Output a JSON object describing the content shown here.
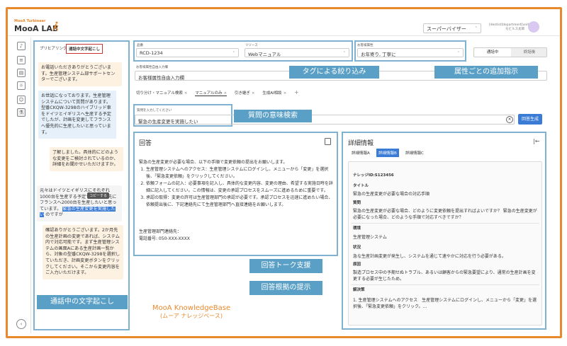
{
  "header": {
    "logo_sub": "MooA Turbineer",
    "logo": "MooA LAB",
    "role": "スーパーバイザー",
    "user_line1": "[dentist]department[unit]",
    "user_line2": "モビルス太郎"
  },
  "left_panel": {
    "tab_preview": "プリヒアリング",
    "tab_transcript": "通話中文字起こし",
    "messages": [
      {
        "type": "orange",
        "text": "お電話いただきありがとうございます。生産管理システム部サポートセンターでございます。"
      },
      {
        "type": "blue",
        "text": "お世話になっております。生産管理システムについて質問があります。型番CKQW-3298のハイブリッド車をドイツとイギリスへ生産する予定でしたが、計画を変更してフランスへ優先的に生産したいと思っています。"
      },
      {
        "type": "orange",
        "text": "了解しました。具体的にどのような変更をご検討されているのか、詳細をお聞かせいただけますか。"
      },
      {
        "type": "grey",
        "text_before": "元々はドイツとイギリスにそれぞれ1000台を生産する予定でしたが、先にフランスへ2000台を生産したいと思っています。",
        "highlight": "緊急の生産変更を実施したい",
        "text_after": "のですが"
      },
      {
        "type": "orange",
        "text": "確認ありがとうございます。2か月先の生産計画の変更であれば、システム内で対応可能です。まず生産管理システムの画面Aにある生産計画一覧から、対象の型番CKQW-3298を選択していただき、計画変更ボタンをクリックしてください。そこから変更内容をご入力いただけます。"
      }
    ],
    "tooltip": "コピーする"
  },
  "filters": {
    "product_label": "品番",
    "product_value": "RCD-1234",
    "resource_label": "リソース",
    "resource_value": "Webマニュアル",
    "attr_label": "お客様属性",
    "attr_value": "お年寄り, 丁寧に",
    "toggle_on": "通話中",
    "toggle_off": "終話後",
    "free_input_label": "お客様属性自由入力欄",
    "free_input_placeholder": "お客様属性自由入力欄"
  },
  "chips": [
    "切り分け・マニュアル検索",
    "マニュアルのみ",
    "引き継ぎ",
    "生成AI相談"
  ],
  "question": {
    "label": "質問を入力してください",
    "value": "緊急の生産変更を実施したい",
    "generate_button": "回答生成"
  },
  "answer": {
    "title": "回答",
    "intro": "緊急の生産変更が必要な場合、以下の手順で変更依頼の提出をお願いします。",
    "steps": [
      "生産管理システムへのアクセス：生産管理システムにログインし、メニューから「変更」を選択後、「緊急変更依頼」をクリックしてください。",
      "依頼フォームの記入：必要事項を記入し、具体的な変更内容、変更の理由、希望する実施日時を詳細に記入してください。この情報は、変更の承認プロセスをスムーズに進めるために重要です。",
      "承認の取得：変更の許可は生産管理部門の承認が必要です。承認プロセスを迅速に進めたい場合、依頼提出後に、下記連絡先にて生産管理部門へ直接連絡をお願いします。"
    ],
    "contact_line1": "生産管理部門連絡先：",
    "contact_line2": "電話番号: 050-XXX-XXXX"
  },
  "detail": {
    "title": "詳細情報",
    "tabs": [
      "詳細情報A",
      "詳細情報B",
      "詳細情報C"
    ],
    "knowledge_id": "ナレッジID:S123456",
    "rows": [
      {
        "k": "タイトル",
        "v": "緊急の生産変更が必要な場合の対応手順"
      },
      {
        "k": "質問",
        "v": "緊急の生産変更が必要な場合、どのように変更依頼を提出すればよいですか？ 緊急の生産変更が必要になった場合、どのような手順で対応すべきですか？"
      },
      {
        "k": "環境",
        "v": "生産管理システム"
      },
      {
        "k": "状況",
        "v": "急な生産計画変更が発生し、システムを通じて速やかに対応を行う必要がある。"
      },
      {
        "k": "原因",
        "v": "製造プロセス中の予期せぬトラブル、あるいは顧客からの緊急要望により、通常の生産計画を変更する必要が生じたため。"
      },
      {
        "k": "解決策",
        "v": "1. 生産管理システムへのアクセス　生産管理システムにログインし、メニューから「変更」を選択後、「緊急変更依頼」をクリック。..."
      }
    ]
  },
  "callouts": {
    "tag_filter": "タグによる絞り込み",
    "attr_instruction": "属性ごとの追加指示",
    "semantic_search": "質問の意味検索",
    "talk_support": "回答トーク支援",
    "evidence": "回答根拠の提示",
    "transcript": "通話中の文字起こし"
  },
  "kb": {
    "line1": "MooA KnowledgeBase",
    "line2": "(ムーア ナレッジベース)"
  },
  "colors": {
    "frame": "#e8892e",
    "callout": "#5a9fc6",
    "accent": "#3a7bd5"
  }
}
